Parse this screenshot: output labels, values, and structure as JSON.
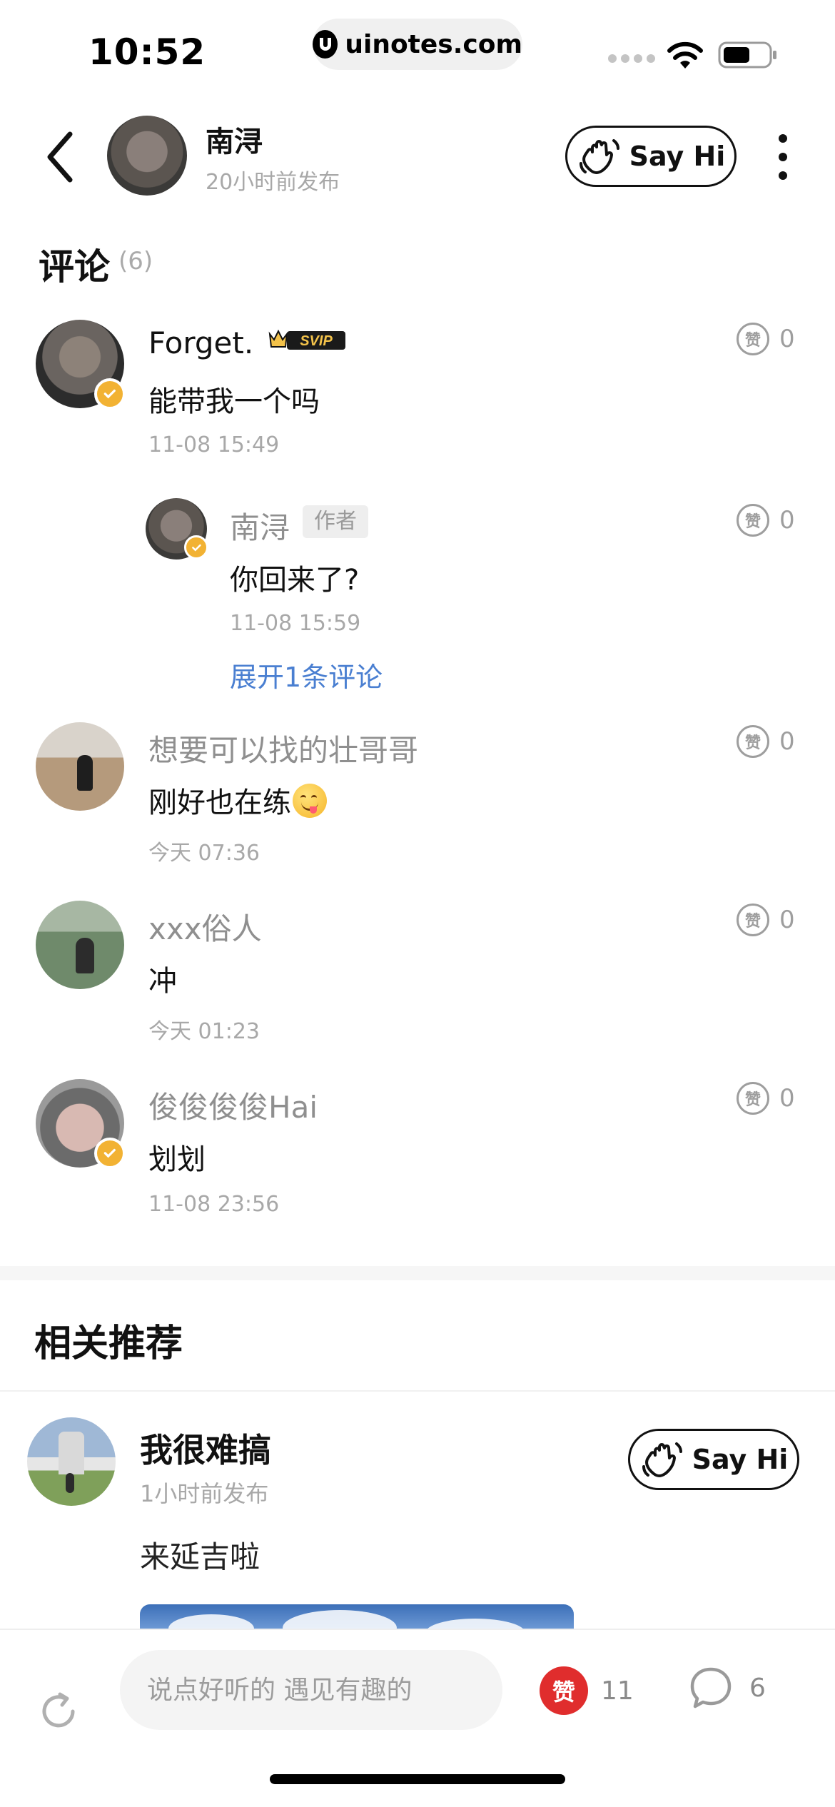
{
  "status_bar": {
    "time": "10:52",
    "url": "uinotes.com",
    "icons": [
      "signal-dots-icon",
      "wifi-icon",
      "battery-icon"
    ]
  },
  "header": {
    "author_name": "南浔",
    "author_time": "20小时前发布",
    "say_hi_label": "Say Hi"
  },
  "comments_section": {
    "title": "评论",
    "count": "(6)",
    "expand_label": "展开1条评论",
    "author_tag": "作者",
    "items": [
      {
        "name": "Forget.",
        "badge": "SVIP",
        "text": "能带我一个吗",
        "time": "11-08 15:49",
        "likes": "0"
      },
      {
        "name": "南浔",
        "text": "你回来了?",
        "time": "11-08 15:59",
        "likes": "0"
      },
      {
        "name": "想要可以找的壮哥哥",
        "text": "刚好也在练",
        "time": "今天 07:36",
        "likes": "0"
      },
      {
        "name": "xxx俗人",
        "text": "冲",
        "time": "今天 01:23",
        "likes": "0"
      },
      {
        "name": "俊俊俊俊Hai",
        "text": "划划",
        "time": "11-08 23:56",
        "likes": "0"
      }
    ],
    "like_icon_char": "赞"
  },
  "recommendations": {
    "title": "相关推荐",
    "post": {
      "name": "我很难搞",
      "time": "1小时前发布",
      "text": "来延吉啦",
      "say_hi_label": "Say Hi"
    }
  },
  "bottom_bar": {
    "input_placeholder": "说点好听的 遇见有趣的",
    "like_icon_char": "赞",
    "like_count": "11",
    "comment_count": "6"
  },
  "colors": {
    "accent_blue": "#4a7fd1",
    "like_red": "#e02d2d",
    "verify_gold": "#f2b233"
  }
}
